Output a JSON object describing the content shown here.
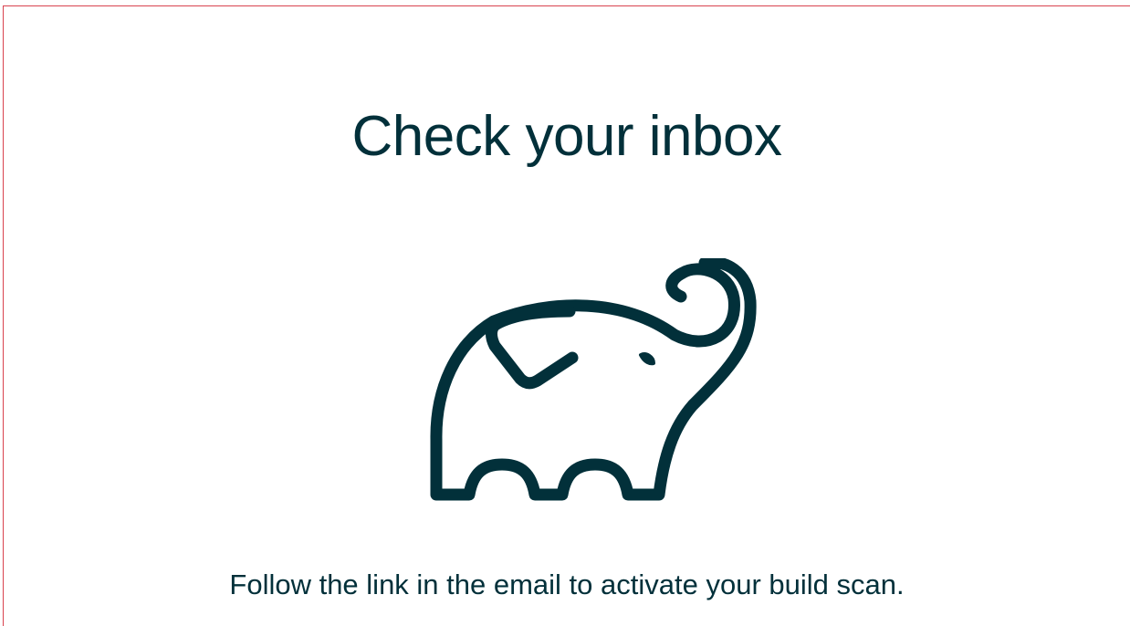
{
  "page": {
    "title": "Check your inbox",
    "message": "Follow the link in the email to activate your build scan."
  },
  "logo": {
    "icon": "elephant-icon",
    "color": "#02303a"
  },
  "colors": {
    "text": "#02303a",
    "frame_border": "#d9434f",
    "background": "#ffffff"
  }
}
